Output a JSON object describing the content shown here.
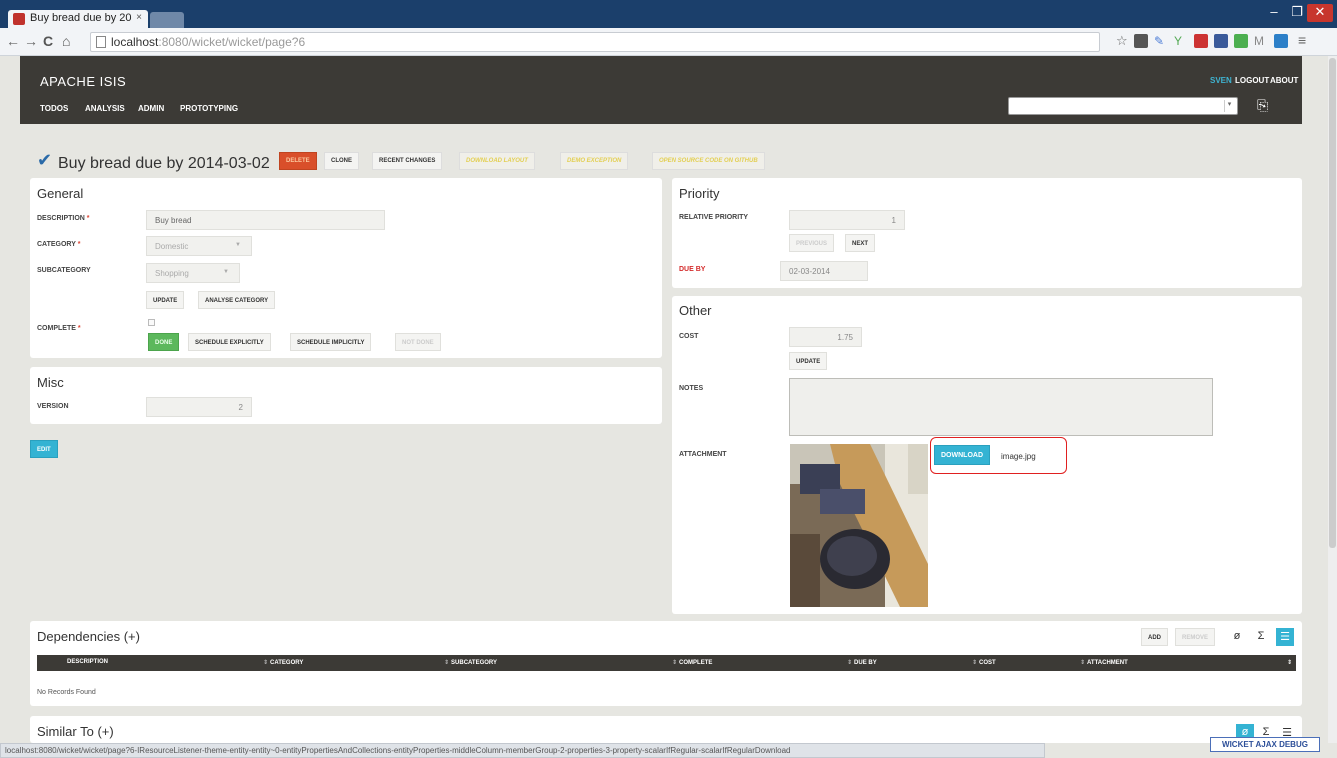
{
  "browser": {
    "tab_title": "Buy bread due by 20",
    "tab_close": "×",
    "url_host": "localhost",
    "url_rest": ":8080/wicket/wicket/page?6",
    "status_url": "localhost:8080/wicket/wicket/page?6-IResourceListener-theme-entity-entity~0-entityPropertiesAndCollections-entityProperties-middleColumn-memberGroup-2-properties-3-property-scalarIfRegular-scalarIfRegularDownload"
  },
  "app": {
    "brand": "APACHE ISIS",
    "menu": [
      "TODOS",
      "ANALYSIS",
      "ADMIN",
      "PROTOTYPING"
    ],
    "user": "SVEN",
    "logout": "LOGOUT",
    "about": "ABOUT"
  },
  "entity": {
    "title": "Buy bread due by 2014-03-02",
    "actions": {
      "delete": "DELETE",
      "clone": "CLONE",
      "recent_changes": "RECENT CHANGES",
      "download_layout": "DOWNLOAD LAYOUT",
      "demo_exception": "DEMO EXCEPTION",
      "open_source": "OPEN SOURCE CODE ON GITHUB"
    }
  },
  "general": {
    "title": "General",
    "description_label": "DESCRIPTION",
    "description_value": "Buy bread",
    "category_label": "CATEGORY",
    "category_value": "Domestic",
    "subcategory_label": "SUBCATEGORY",
    "subcategory_value": "Shopping",
    "update": "UPDATE",
    "analyse_category": "ANALYSE CATEGORY",
    "complete_label": "COMPLETE",
    "required_mark": "*",
    "done": "DONE",
    "schedule_explicitly": "SCHEDULE EXPLICITLY",
    "schedule_implicitly": "SCHEDULE IMPLICITLY",
    "not_done": "NOT DONE"
  },
  "misc": {
    "title": "Misc",
    "version_label": "VERSION",
    "version_value": "2",
    "edit": "EDIT"
  },
  "priority": {
    "title": "Priority",
    "relative_priority_label": "RELATIVE PRIORITY",
    "relative_priority_value": "1",
    "previous": "PREVIOUS",
    "next": "NEXT",
    "due_by_label": "DUE BY",
    "due_by_value": "02-03-2014"
  },
  "other": {
    "title": "Other",
    "cost_label": "COST",
    "cost_value": "1.75",
    "update": "UPDATE",
    "notes_label": "NOTES",
    "attachment_label": "ATTACHMENT",
    "download": "DOWNLOAD",
    "filename": "image.jpg"
  },
  "dependencies": {
    "title": "Dependencies (+)",
    "add": "ADD",
    "remove": "REMOVE",
    "columns": [
      "DESCRIPTION",
      "CATEGORY",
      "SUBCATEGORY",
      "COMPLETE",
      "DUE BY",
      "COST",
      "ATTACHMENT"
    ],
    "empty": "No Records Found"
  },
  "similar": {
    "title": "Similar To (+)"
  },
  "debug": "WICKET AJAX DEBUG"
}
